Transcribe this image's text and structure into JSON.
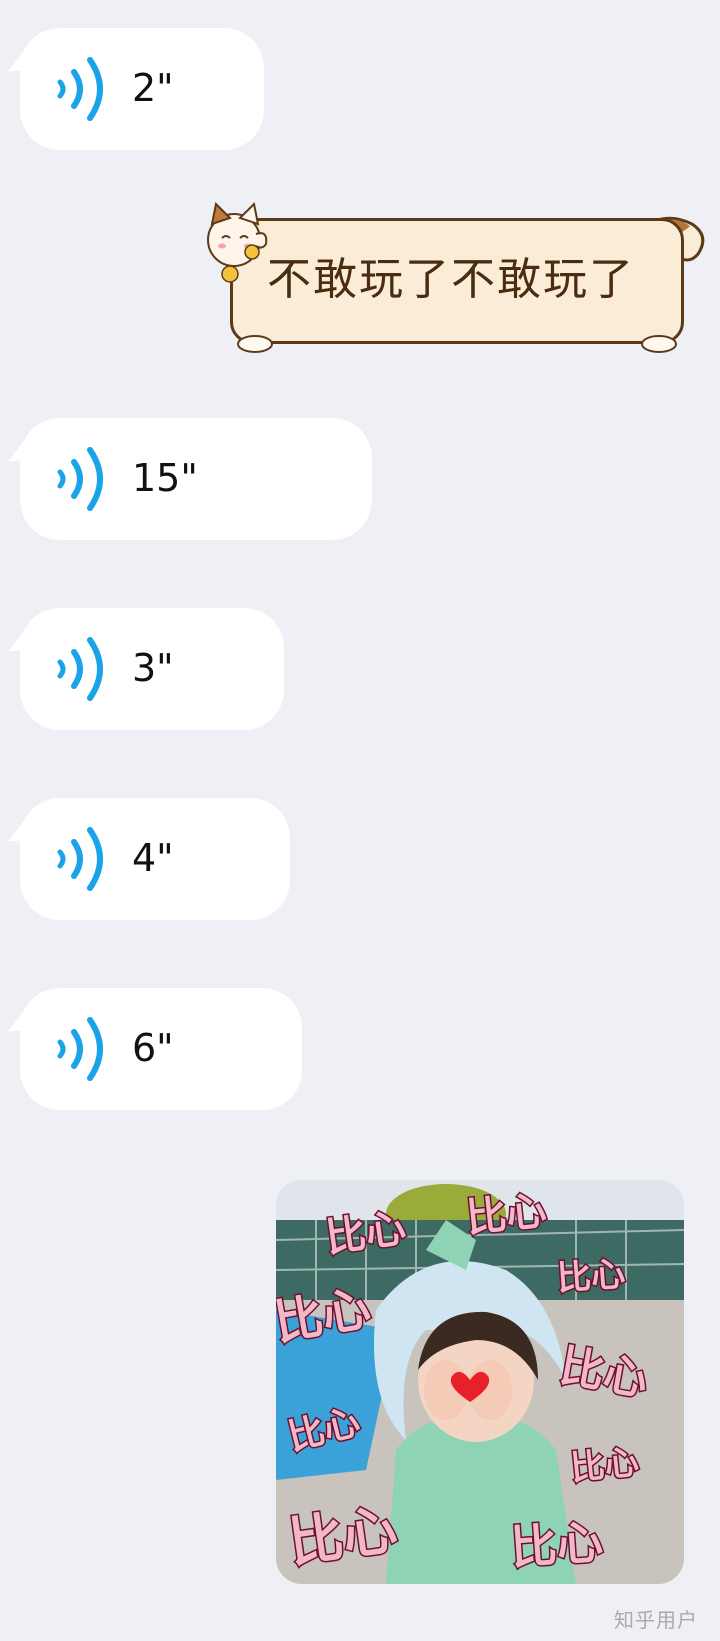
{
  "messages": [
    {
      "type": "voice",
      "duration": "2\""
    },
    {
      "type": "sticker",
      "text": "不敢玩了不敢玩了"
    },
    {
      "type": "voice",
      "duration": "15\""
    },
    {
      "type": "voice",
      "duration": "3\""
    },
    {
      "type": "voice",
      "duration": "4\""
    },
    {
      "type": "voice",
      "duration": "6\""
    },
    {
      "type": "image",
      "caption_words": [
        "比心",
        "比心",
        "比心",
        "比心",
        "比心",
        "比心",
        "比心",
        "比心",
        "比心"
      ]
    }
  ],
  "watermark": "知乎用户",
  "colors": {
    "background": "#eef0f5",
    "voice_icon": "#1aa3e8",
    "sticker_bubble": "#fbecd8",
    "sticker_border": "#5b3a1a"
  },
  "icons": {
    "voice": "voice-wave-icon",
    "cat": "lucky-cat-icon"
  }
}
